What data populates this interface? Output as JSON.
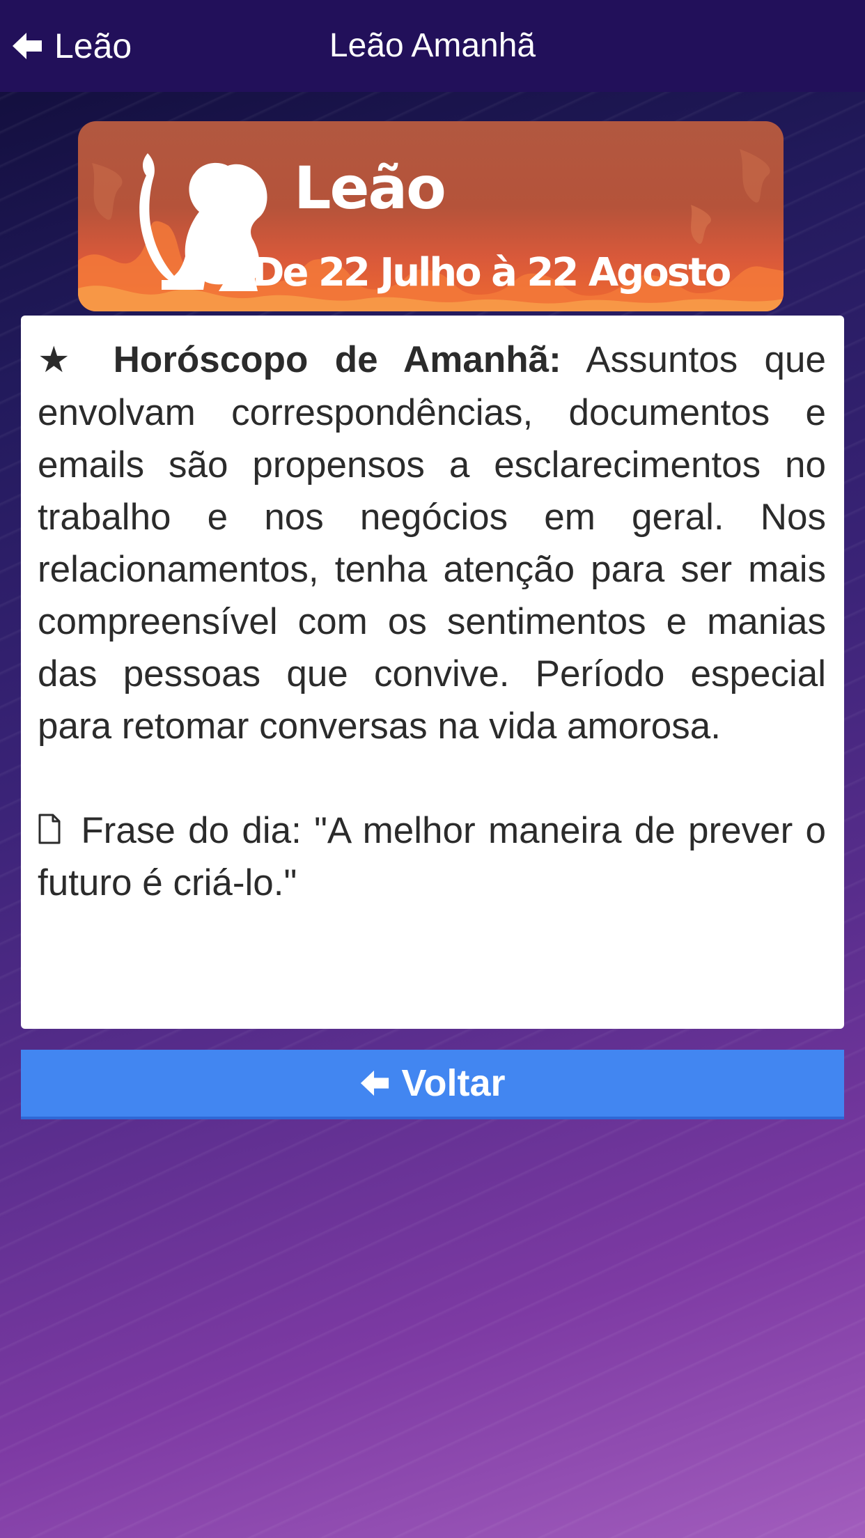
{
  "header": {
    "back_label": "Leão",
    "title": "Leão Amanhã"
  },
  "banner": {
    "sign_name": "Leão",
    "date_range": "De 22 Julho à 22 Agosto"
  },
  "horoscope": {
    "star": "★",
    "heading": "Horóscopo de Amanhã:",
    "text": "Assuntos que envolvam correspondências, documentos e emails são propensos a esclarecimentos no trabalho e nos negócios em geral. Nos relacionamentos, tenha atenção para ser mais compreensível com os sentimentos e manias das pessoas que convive. Período especial para retomar conversas na vida amorosa."
  },
  "phrase": {
    "text": "Frase do dia: \"A melhor maneira de prever o futuro é criá-lo.\""
  },
  "back_button": {
    "label": "Voltar"
  },
  "icons": {
    "header_back": "arrow-left-icon",
    "document": "file-icon",
    "button_back": "arrow-left-icon",
    "banner": "lion-icon"
  },
  "colors": {
    "navbar": "#22105a",
    "button": "#4286f1",
    "banner": "#b5533a"
  }
}
